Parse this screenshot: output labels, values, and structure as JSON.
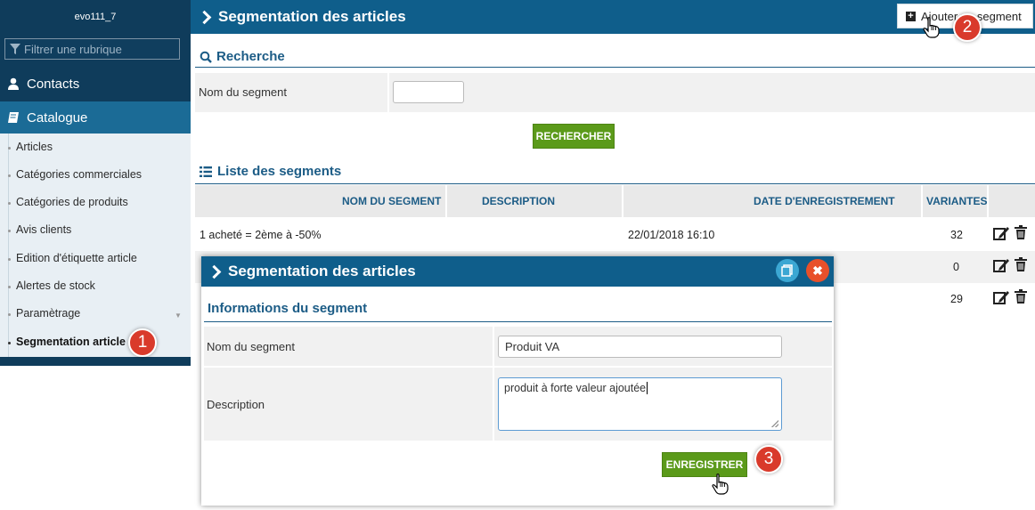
{
  "sidebar": {
    "title": "evo111_7",
    "filter_placeholder": "Filtrer une rubrique",
    "contacts": "Contacts",
    "catalogue": "Catalogue",
    "items": [
      {
        "label": "Articles"
      },
      {
        "label": "Catégories commerciales"
      },
      {
        "label": "Catégories de produits"
      },
      {
        "label": "Avis clients"
      },
      {
        "label": "Edition d'étiquette article"
      },
      {
        "label": "Alertes de stock"
      },
      {
        "label": "Paramètrage"
      },
      {
        "label": "Segmentation article"
      }
    ]
  },
  "header": {
    "title": "Segmentation des articles",
    "add_button": "Ajouter un segment"
  },
  "search": {
    "heading": "Recherche",
    "field_label": "Nom du segment",
    "field_value": "",
    "button": "RECHERCHER"
  },
  "list": {
    "heading": "Liste des segments",
    "columns": [
      "NOM DU SEGMENT",
      "DESCRIPTION",
      "DATE D'ENREGISTREMENT",
      "VARIANTES"
    ],
    "rows": [
      {
        "name": "1 acheté = 2ème à -50%",
        "description": "",
        "date": "22/01/2018 16:10",
        "variantes": "32"
      },
      {
        "name": "",
        "description": "",
        "date": "",
        "variantes": "0"
      },
      {
        "name": "",
        "description": "",
        "date": "",
        "variantes": "29"
      }
    ]
  },
  "modal": {
    "title": "Segmentation des articles",
    "subheading": "Informations du segment",
    "name_label": "Nom du segment",
    "name_value": "Produit VA",
    "desc_label": "Description",
    "desc_value": "produit à forte valeur ajoutée",
    "save_button": "ENREGISTRER",
    "close_symbol": "✖"
  },
  "badges": [
    "1",
    "2",
    "3"
  ],
  "colors": {
    "sidebar_bg": "#0f3c5b",
    "header_bg": "#0f5e8b",
    "accent_text": "#1c5c86",
    "green_button": "#5b9a1a",
    "badge_red": "#d93a2b"
  }
}
